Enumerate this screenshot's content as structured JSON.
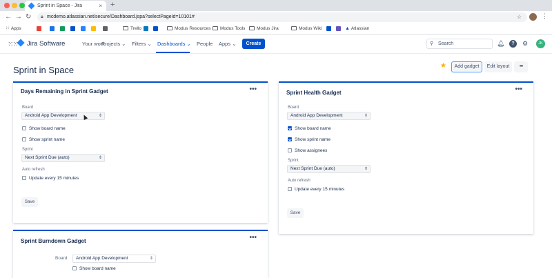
{
  "browser": {
    "tab_title": "Sprint in Space - Jira",
    "url": "mcdemo.atlassian.net/secure/Dashboard.jspa?selectPageId=10101#",
    "bookmarks": [
      "Apps",
      "Trello",
      "Modus Resources",
      "Modus Tools",
      "Modus Jira",
      "Modus Wiki",
      "Atlassian"
    ]
  },
  "nav": {
    "product": "Jira Software",
    "items": [
      "Your work",
      "Projects",
      "Filters",
      "Dashboards",
      "People",
      "Apps"
    ],
    "create": "Create",
    "search_placeholder": "Search",
    "user_initials": "JK"
  },
  "page": {
    "title": "Sprint in Space",
    "add_gadget": "Add gadget",
    "edit_layout": "Edit layout",
    "more": "•••"
  },
  "gadgets": {
    "days_remaining": {
      "title": "Days Remaining in Sprint Gadget",
      "board_label": "Board",
      "board_value": "Android App Development",
      "show_board_name": "Show board name",
      "show_sprint_name": "Show sprint name",
      "sprint_label": "Sprint",
      "sprint_value": "Next Sprint Due (auto)",
      "auto_refresh_label": "Auto refresh",
      "update_every": "Update every 15 minutes",
      "save": "Save"
    },
    "sprint_health": {
      "title": "Sprint Health Gadget",
      "board_label": "Board",
      "board_value": "Android App Development",
      "show_board_name": "Show board name",
      "show_sprint_name": "Show sprint name",
      "show_assignees": "Show assignees",
      "sprint_label": "Sprint",
      "sprint_value": "Next Sprint Due (auto)",
      "auto_refresh_label": "Auto refresh",
      "update_every": "Update every 15 minutes",
      "save": "Save"
    },
    "burndown": {
      "title": "Sprint Burndown Gadget",
      "board_label": "Board",
      "board_value": "Android App Development",
      "show_board_name": "Show board name"
    }
  },
  "colors": {
    "brand": "#0052cc",
    "star": "#ffab00"
  }
}
